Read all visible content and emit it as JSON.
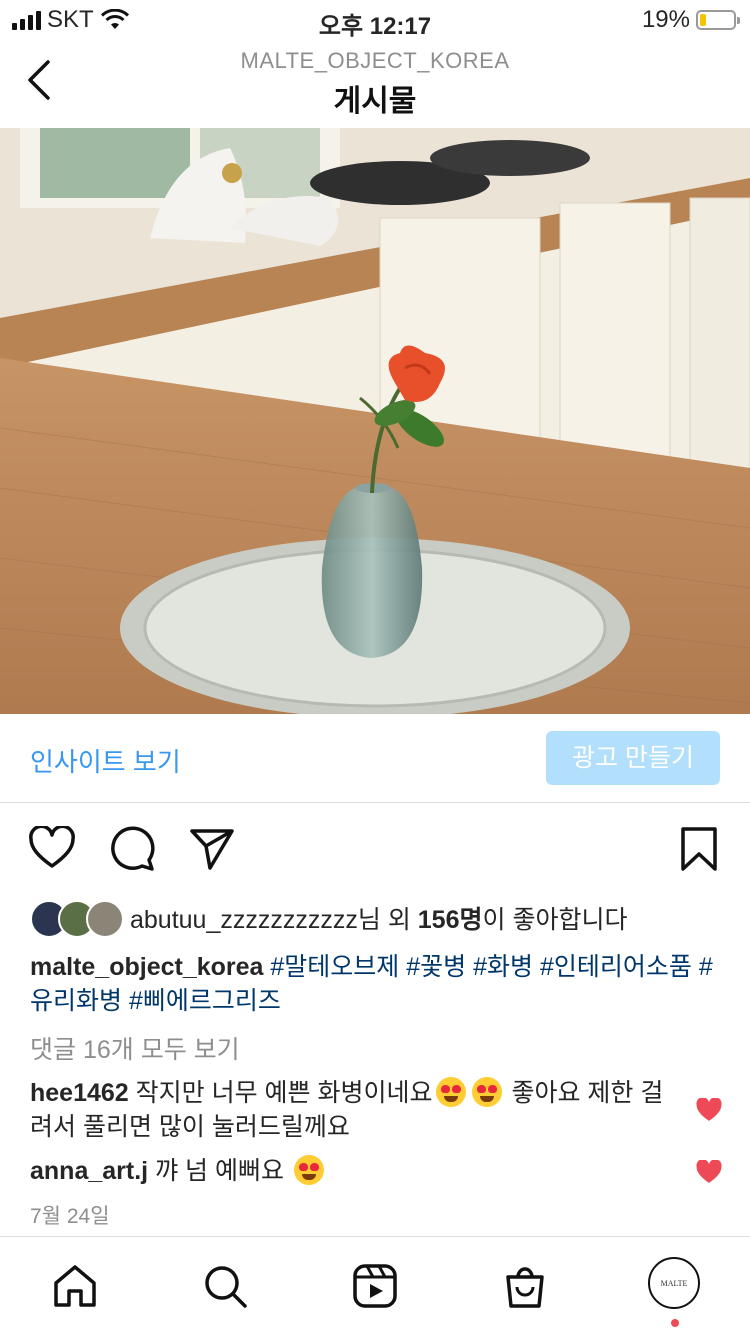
{
  "status_bar": {
    "carrier": "SKT",
    "time": "오후 12:17",
    "battery_percent": "19%",
    "battery_level": 0.19
  },
  "header": {
    "account": "MALTE_OBJECT_KOREA",
    "title": "게시물"
  },
  "post_image": {
    "description_icon": "photo"
  },
  "insight": {
    "link_label": "인사이트 보기",
    "ad_button_label": "광고 만들기"
  },
  "likes": {
    "user": "abutuu_zzzzzzzzzzz",
    "middle": "님 외 ",
    "count": "156명",
    "suffix": "이 좋아합니다"
  },
  "caption": {
    "user": "malte_object_korea",
    "tags": [
      "#말테오브제",
      "#꽃병",
      "#화병",
      "#인테리어소품",
      "#유리화병",
      "#삐에르그리즈"
    ]
  },
  "view_all_comments": "댓글 16개 모두 보기",
  "comments": [
    {
      "user": "hee1462",
      "text_before": "작지만 너무 예쁜 화병이네요",
      "text_after": " 좋아요 제한 걸려서 풀리면 많이 눌러드릴께요"
    },
    {
      "user": "anna_art.j",
      "text_before": "꺄 넘 예뻐요",
      "text_after": ""
    }
  ],
  "post_date": "7월 24일",
  "profile_logo_text": "MALTE",
  "colors": {
    "link": "#3897f0",
    "button_bg": "#b2dffc",
    "hashtag": "#00376b",
    "like_heart": "#ed4956",
    "battery": "#f5c400"
  }
}
